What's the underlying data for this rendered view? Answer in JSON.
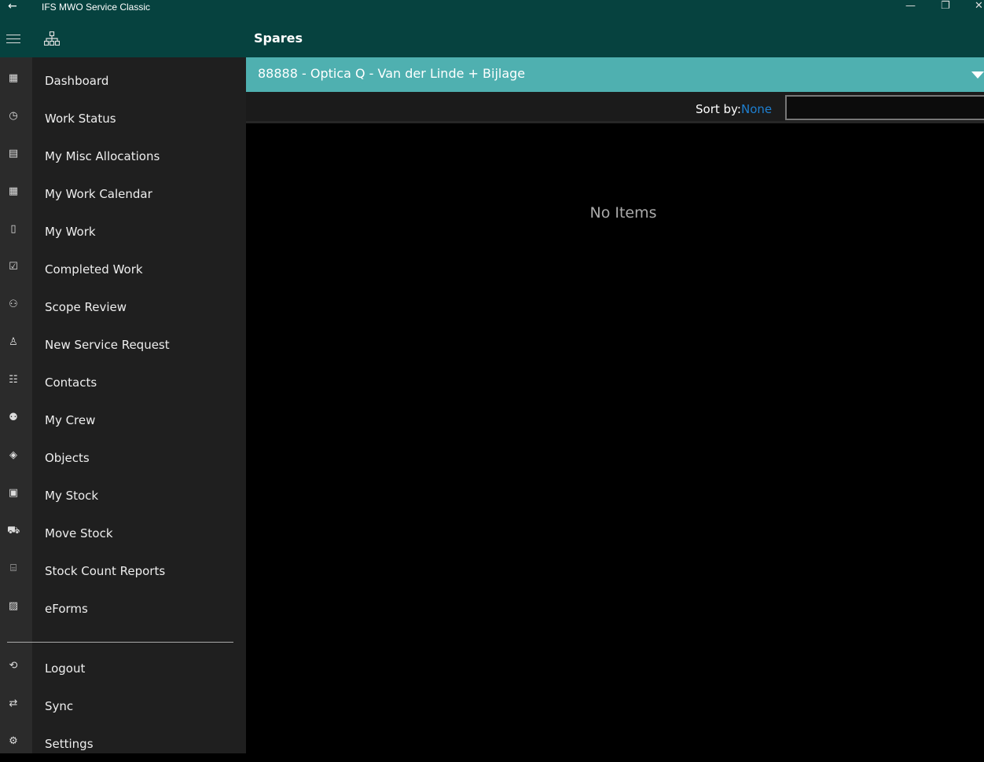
{
  "window": {
    "title": "IFS MWO Service Classic",
    "back": "←",
    "minimize": "—",
    "restore": "❐",
    "close": "✕"
  },
  "header": {
    "page_title": "Spares"
  },
  "nav": {
    "items": [
      {
        "label": "Dashboard",
        "icon": "grid-icon",
        "glyph": "▦"
      },
      {
        "label": "Work Status",
        "icon": "clock-icon",
        "glyph": "◷"
      },
      {
        "label": "My Misc Allocations",
        "icon": "list-icon",
        "glyph": "▤"
      },
      {
        "label": "My Work Calendar",
        "icon": "calendar-icon",
        "glyph": "▦"
      },
      {
        "label": "My Work",
        "icon": "clipboard-icon",
        "glyph": "▯"
      },
      {
        "label": "Completed Work",
        "icon": "clipboard-check-icon",
        "glyph": "☑"
      },
      {
        "label": "Scope Review",
        "icon": "handshake-icon",
        "glyph": "⚇"
      },
      {
        "label": "New Service Request",
        "icon": "cone-icon",
        "glyph": "♙"
      },
      {
        "label": "Contacts",
        "icon": "contacts-icon",
        "glyph": "☷"
      },
      {
        "label": "My Crew",
        "icon": "people-icon",
        "glyph": "⚉"
      },
      {
        "label": "Objects",
        "icon": "shapes-icon",
        "glyph": "◈"
      },
      {
        "label": "My Stock",
        "icon": "building-icon",
        "glyph": "▣"
      },
      {
        "label": "Move Stock",
        "icon": "truck-icon",
        "glyph": "⛟"
      },
      {
        "label": "Stock Count Reports",
        "icon": "report-icon",
        "glyph": "⌸"
      },
      {
        "label": "eForms",
        "icon": "form-icon",
        "glyph": "▨"
      }
    ],
    "bottom": [
      {
        "label": "Logout",
        "icon": "logout-icon",
        "glyph": "⟲"
      },
      {
        "label": "Sync",
        "icon": "sync-icon",
        "glyph": "⇄"
      },
      {
        "label": "Settings",
        "icon": "gear-icon",
        "glyph": "⚙"
      }
    ]
  },
  "selector": {
    "value": "88888 - Optica Q - Van der Linde + Bijlage"
  },
  "sort": {
    "label": "Sort by:",
    "value": "None",
    "search_value": ""
  },
  "main": {
    "empty_text": "No Items"
  },
  "colors": {
    "titlebar": "#06423f",
    "accent": "#4fb0b0",
    "link": "#1e7fd0"
  }
}
